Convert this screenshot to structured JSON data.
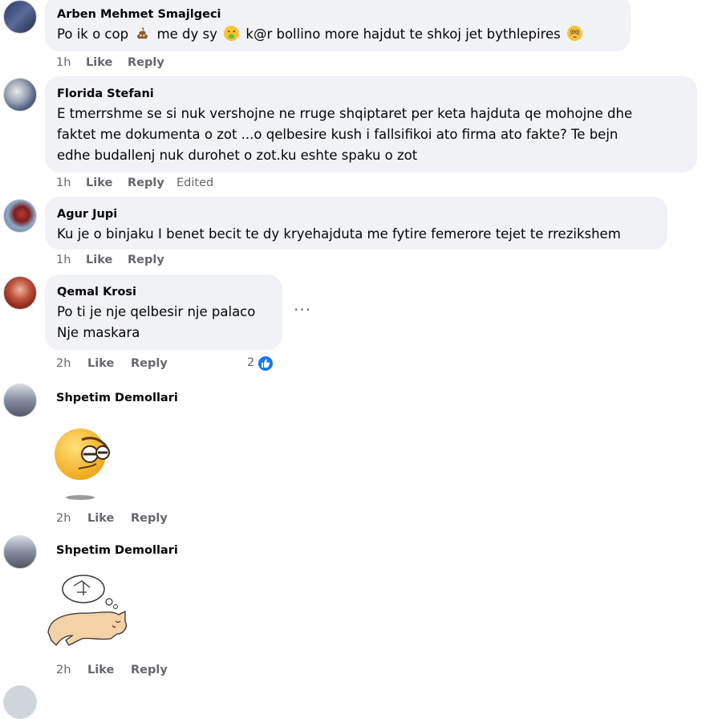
{
  "comments": [
    {
      "author": "Arben Mehmet Smajlgeci",
      "text_parts": [
        "Po ik o cop",
        "me dy sy",
        "k@r bollino more hajdut te shkoj jet bythlepires"
      ],
      "emojis": [
        "poop-emoji",
        "vomit-face-emoji",
        "flushed-face-emoji"
      ],
      "time": "1h",
      "like": "Like",
      "reply": "Reply"
    },
    {
      "author": "Florida Stefani",
      "lines": [
        "E tmerrshme se si nuk vershojne ne rruge shqiptaret per keta hajduta qe mohojne dhe",
        "faktet me dokumenta o zot ...o qelbesire kush i fallsifikoi ato firma ato fakte? Te bejn",
        "edhe budallenj nuk durohet o zot.ku eshte spaku o zot"
      ],
      "time": "1h",
      "like": "Like",
      "reply": "Reply",
      "edited": "Edited"
    },
    {
      "author": "Agur Jupi",
      "lines": [
        "Ku je o binjaku I benet becit te dy kryehajduta me fytire femerore tejet te rrezikshem"
      ],
      "time": "1h",
      "like": "Like",
      "reply": "Reply"
    },
    {
      "author": "Qemal Krosi",
      "lines": [
        "Po ti je nje qelbesir nje palaco",
        "Nje maskara"
      ],
      "time": "2h",
      "like": "Like",
      "reply": "Reply",
      "more": "···",
      "reaction_count": "2",
      "reaction_icon": "thumbs-up-icon"
    },
    {
      "author": "Shpetim Demollari",
      "sticker": "smug-face-sticker",
      "time": "2h",
      "like": "Like",
      "reply": "Reply"
    },
    {
      "author": "Shpetim Demollari",
      "sticker": "sleeping-dog-sticker",
      "time": "2h",
      "like": "Like",
      "reply": "Reply"
    }
  ],
  "colors": {
    "bubble": "#f0f2f5",
    "meta_text": "#65676b",
    "like_badge": "#1877f2"
  }
}
